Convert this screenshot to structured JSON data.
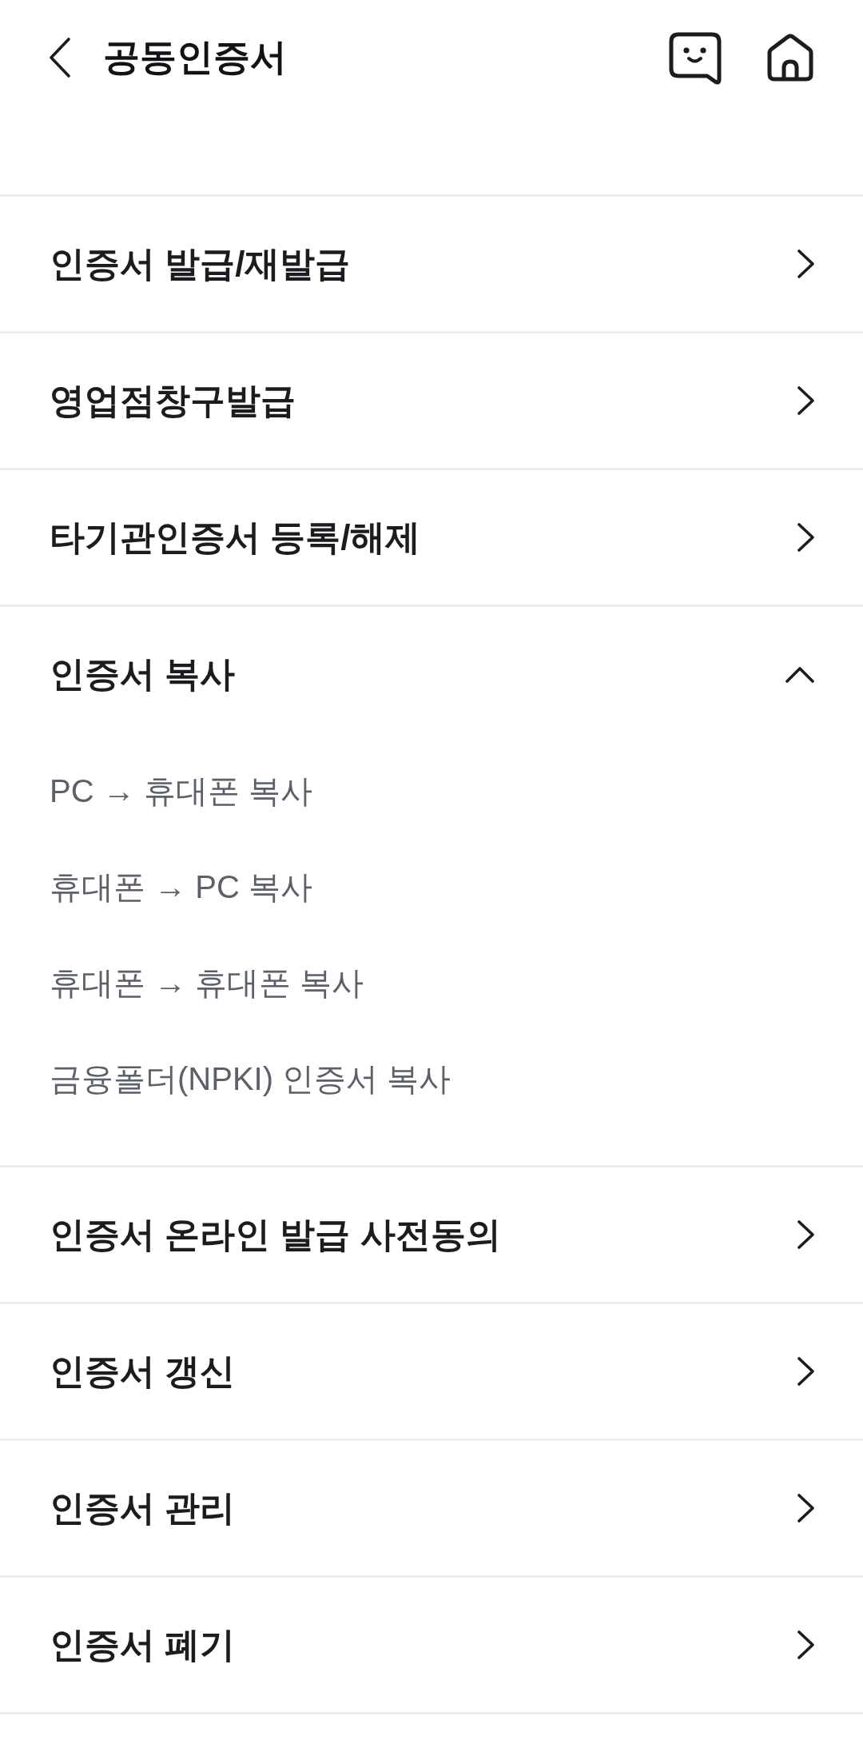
{
  "header": {
    "title": "공동인증서"
  },
  "menu": [
    {
      "label": "인증서 발급/재발급",
      "expanded": false
    },
    {
      "label": "영업점창구발급",
      "expanded": false
    },
    {
      "label": "타기관인증서 등록/해제",
      "expanded": false
    },
    {
      "label": "인증서 복사",
      "expanded": true,
      "children": [
        {
          "label": "PC → 휴대폰 복사"
        },
        {
          "label": "휴대폰 → PC 복사"
        },
        {
          "label": "휴대폰 → 휴대폰 복사"
        },
        {
          "label": "금융폴더(NPKI) 인증서 복사"
        }
      ]
    },
    {
      "label": "인증서 온라인 발급 사전동의",
      "expanded": false
    },
    {
      "label": "인증서 갱신",
      "expanded": false
    },
    {
      "label": "인증서 관리",
      "expanded": false
    },
    {
      "label": "인증서 폐기",
      "expanded": false
    }
  ]
}
